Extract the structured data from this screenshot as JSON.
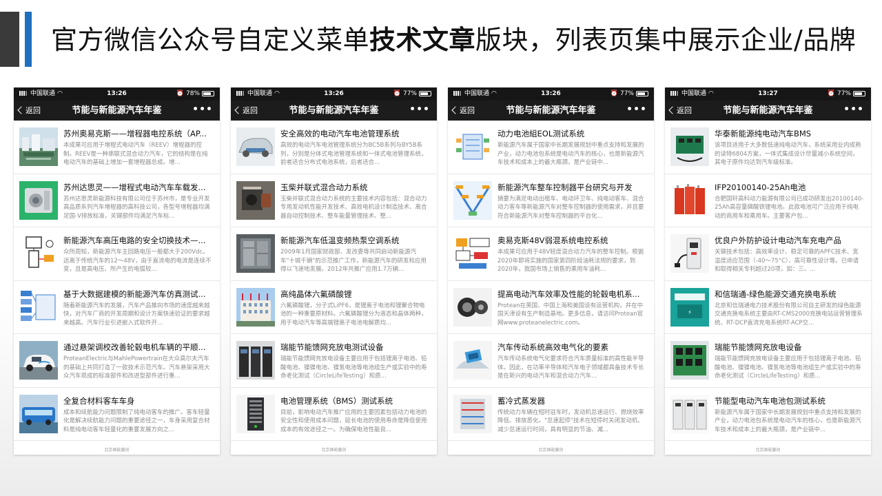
{
  "slide": {
    "title_prefix": "官方微信公众号自定义菜单",
    "title_bold": "技术文章",
    "title_suffix": "版块，列表页集中展示企业/品牌",
    "colors": {
      "dark_bar": "#3a3a3a",
      "blue_bar": "#1f6fbf"
    }
  },
  "phones": [
    {
      "status": {
        "carrier": "中国联通",
        "time": "13:26",
        "battery": "78%",
        "battery_level": 0.78
      },
      "nav": {
        "back": "返回",
        "title": "节能与新能源汽车年鉴",
        "more": "•••"
      },
      "footer": "北京国能赢创",
      "items": [
        {
          "title": "苏州奥易克斯——增程器电控系统（AP...",
          "desc": "本成果可应用于增程式电动汽车（REEV）增程器的控制。REEV是一种串联式混合动力汽车，它的结构是在纯电动汽车的基础上增加一套增程器总成。增...",
          "thumb": "factory"
        },
        {
          "title": "苏州达思灵——增程式电动汽车车载发...",
          "desc": "苏州达思灵新能源科技有限公司位于苏州市，是专业开发高品质系列汽车增程器的高科技公司，各型号增程器均满足国-V排放标准，关键部件均满足汽车标...",
          "thumb": "engine-green"
        },
        {
          "title": "新能源汽车高压电路的安全切换技术—...",
          "desc": "众所周知，新能源汽车主回路电压一般都大于200Vdc。远离于传统汽车的12～48V，由于直流电的电流是连续不变，且是高电压、所产生的电弧较...",
          "thumb": "circuit"
        },
        {
          "title": "基于大数据建模的新能源汽车仿真测试...",
          "desc": "随着新能源汽车的发展，汽车产品推向市场的速度越来越快，对汽车厂商的开发周期和设计方案快速验证的要求越来越高。汽车行业引进嵌入式软件开...",
          "thumb": "flowchart"
        },
        {
          "title": "通过悬架调校改善轮毂电机车辆的平顺...",
          "desc": "ProteanElectric与MahlePowertrain在大众高尔夫汽车的基础上共同打造了一款技术示范汽车。汽车悬架采用大众汽车现成的标准部件和改进型部件进行重...",
          "thumb": "car-white"
        },
        {
          "title": "全复合材料客车车身",
          "desc": "成本和续航能力问题限制了纯电动客车的推广。客车轻量化是解决续航能力问题的重要途径之一，车身采用复合材料是纯电动客车轻量化的重要发展方向之...",
          "thumb": "bus"
        }
      ]
    },
    {
      "status": {
        "carrier": "中国联通",
        "time": "13:26",
        "battery": "77%",
        "battery_level": 0.77
      },
      "nav": {
        "back": "返回",
        "title": "节能与新能源汽车年鉴",
        "more": "•••"
      },
      "footer": "北京国能赢创",
      "items": [
        {
          "title": "安全高效的电动汽车电池管理系统",
          "desc": "高效的电动汽车电池管理系统分为BC5B系列与BY5B系列，分别是分体式电池管理系统和一体式电池管理系统，前者适合分布式电池系统，后者适合...",
          "thumb": "car-xray"
        },
        {
          "title": "玉柴并联式混合动力系统",
          "desc": "玉柴并联式混合动力系统的主要技术内容包括：混合动力专用发动机性能开发技术、高效电机设计制造技术、离合器自动控制技术、整车能量管理技术、整...",
          "thumb": "engine-dark"
        },
        {
          "title": "新能源汽车低温变频热泵空调系统",
          "desc": "2009年1月国家财政部、发改委等共同启动新能源汽车\"十城千辆\"的示范推广工作，新能源汽车的研发和应用得以飞速地发展。2012年共推广应用1.7万辆...",
          "thumb": "hvac"
        },
        {
          "title": "高纯晶体六氟磷酸锂",
          "desc": "六氟磷酸锂，分子式LiPF6，是锂离子电池和锂聚合物电池的一种重要原材料。六氟磷酸锂分为液态和晶体两种，用于电动汽车等高端锂离子电池电解质均...",
          "thumb": "building"
        },
        {
          "title": "瑞能节能馈网充放电测试设备",
          "desc": "瑞能节能馈网充放电设备主要应用于包括锂离子电池、铅酸电池、镍镍电池、镍氢电池等电池组生产或实验中的寿命老化测试（CircleLifeTesting）和质...",
          "thumb": "cabinets"
        },
        {
          "title": "电池管理系统（BMS）测试系统",
          "desc": "目前，影响电动汽车推广应用的主要因素包括动力电池的安全性和使用成本问题，延长电池的使用寿命是降低使用成本的有效途径之一。为确保电池性能良...",
          "thumb": "rack"
        }
      ]
    },
    {
      "status": {
        "carrier": "中国联通",
        "time": "13:26",
        "battery": "77%",
        "battery_level": 0.77
      },
      "nav": {
        "back": "返回",
        "title": "节能与新能源汽车年鉴",
        "more": "•••"
      },
      "footer": "北京国能赢创",
      "items": [
        {
          "title": "动力电池組EOL测试系统",
          "desc": "新能源汽车属于国家中长期发展规划中重点支持和发展的产业，动力电池包系统是电动汽车的核心，也是新能源汽车技术和成本上的最大瓶颈，是产业链中...",
          "thumb": "diagram-blue"
        },
        {
          "title": "新能源汽车整车控制器平台研究与开发",
          "desc": "摘要为满足电动出租车、电动环卫车、纯电动客车、混合动力客车等新能源汽车对整车控制器的使用需求，并且要符合新能源汽车对整车控制器的平台化...",
          "thumb": "v-model"
        },
        {
          "title": "奥易克斯48V弱混系统电控系统",
          "desc": "本成果可应用于48V轻度混合动力汽车的整车控制。根据2020年即将实施的国家第四阶段油耗法规的要求，到2020年，我国市场上销售的乘用车油耗...",
          "thumb": "schematic"
        },
        {
          "title": "提高电动汽车效率及性能的轮毂电机系...",
          "desc": "Protean在英国、中国上海和美国设有运营机构，并在中国天津设有生产制造基地。更多信息，请访问Protean官网www.proteanelectric.com。",
          "thumb": "hub-motor"
        },
        {
          "title": "汽车传动系统高效电气化的要素",
          "desc": "汽车传动系统电气化要求符合汽车质量标准的高性能半导体。因此，在功率半导体和汽车电子领域都具备技术专长是在新兴的电动汽车和混合动力汽车...",
          "thumb": "chip"
        },
        {
          "title": "蓄冷式蒸发器",
          "desc": "传统动力车辆在短时驻车时，发动机怠速运行、燃烧效率降低、排放恶化。\"怠速起停\"技术在短停时关闭发动机、减少怠速运行时间，具有明显的节油、减...",
          "thumb": "evaporator"
        }
      ]
    },
    {
      "status": {
        "carrier": "中国联通",
        "time": "13:27",
        "battery": "77%",
        "battery_level": 0.77
      },
      "nav": {
        "back": "返回",
        "title": "节能与新能源汽车年鉴",
        "more": "•••"
      },
      "footer": "北京国能赢创",
      "items": [
        {
          "title": "华泰新能源纯电动汽车BMS",
          "desc": "该项目适用于大多数低速纯电动汽车，系统采用业内成熟的读特6804方案，一体式集成设计尽量减小系统空间，其电子原件均达到汽车级标准。",
          "thumb": "bms-board"
        },
        {
          "title": "IFP20100140-25Ah电池",
          "desc": "合肥国轩高科动力能源有限公司已成功研发出20100140-25Ah高容量磷酸铁锂电池。此款电池可广泛应用于纯电动的商用车和乘用车。主要客户包...",
          "thumb": "battery-red"
        },
        {
          "title": "优良户外防护设计电动汽车充电产品",
          "desc": "关键技术包括：高效率设计、稳定可靠的APFC技术、宽温度适应范围（-40～75°C）、高可靠性设计等。已申请和取得相关专利超过20项，如：三、...",
          "thumb": "charger"
        },
        {
          "title": "和信瑞通-绿色能源交通充换电系统",
          "desc": "北京和信瑞通电力技术股份有限公司自主研发的绿色能源交通充换电系统主要由RT-CMS2000充换电站运营管理系统、RT-DCP直流充电系统RT-ACP交...",
          "thumb": "teal-station"
        },
        {
          "title": "瑞能节能馈网充放电设备",
          "desc": "瑞能节能馈网充放电设备主要应用于包括锂离子电池、铅酸电池、镍镍电池、镍氢电池等电池组生产或实验中的寿命老化测试（CircleLifeTesting）和质...",
          "thumb": "board-green"
        },
        {
          "title": "节能型电动汽车电池包测试系统",
          "desc": "新能源汽车属于国家中长期发展规划中重点支持和发展的产业，动力电池包系统是电动汽车的核心，也是新能源汽车技术和成本上的最大瓶颈，是产业链中...",
          "thumb": "test-cabinets"
        }
      ]
    }
  ]
}
